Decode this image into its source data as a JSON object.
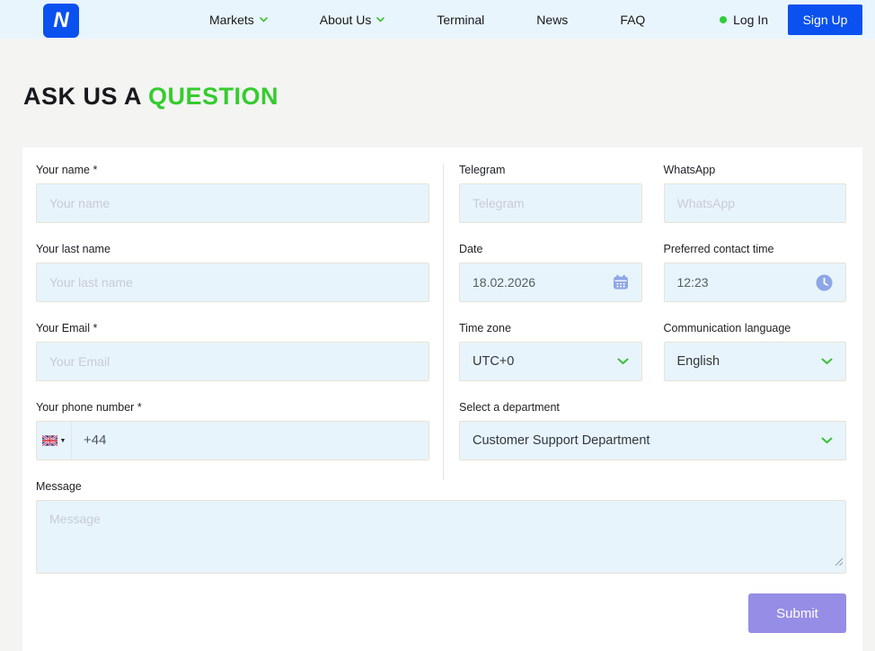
{
  "nav": {
    "logo_letter": "N",
    "items": [
      {
        "label": "Markets"
      },
      {
        "label": "About Us"
      },
      {
        "label": "Terminal"
      },
      {
        "label": "News"
      },
      {
        "label": "FAQ"
      }
    ],
    "login_label": "Log In",
    "signup_label": "Sign Up"
  },
  "heading": {
    "prefix": "ASK US A",
    "highlight": "QUESTION"
  },
  "form": {
    "your_name": {
      "label": "Your name *",
      "placeholder": "Your name"
    },
    "telegram": {
      "label": "Telegram",
      "placeholder": "Telegram"
    },
    "whatsapp": {
      "label": "WhatsApp",
      "placeholder": "WhatsApp"
    },
    "last_name": {
      "label": "Your last name",
      "placeholder": "Your last name"
    },
    "date": {
      "label": "Date",
      "value": "18.02.2026"
    },
    "contact_time": {
      "label": "Preferred contact time",
      "value": "12:23"
    },
    "email": {
      "label": "Your Email *",
      "placeholder": "Your Email"
    },
    "timezone": {
      "label": "Time zone",
      "value": "UTC+0"
    },
    "language": {
      "label": "Communication language",
      "value": "English"
    },
    "phone": {
      "label": "Your phone number *",
      "dial_code": "+44",
      "flag": "uk-flag"
    },
    "department": {
      "label": "Select a department",
      "value": "Customer Support Department"
    },
    "message": {
      "label": "Message",
      "placeholder": "Message"
    },
    "submit_label": "Submit"
  },
  "colors": {
    "brand_blue": "#0b51ef",
    "accent_green": "#35cc2f",
    "submit_purple": "#968de6",
    "input_bg": "#e8f4fc",
    "nav_bg": "#e9f5fd"
  }
}
